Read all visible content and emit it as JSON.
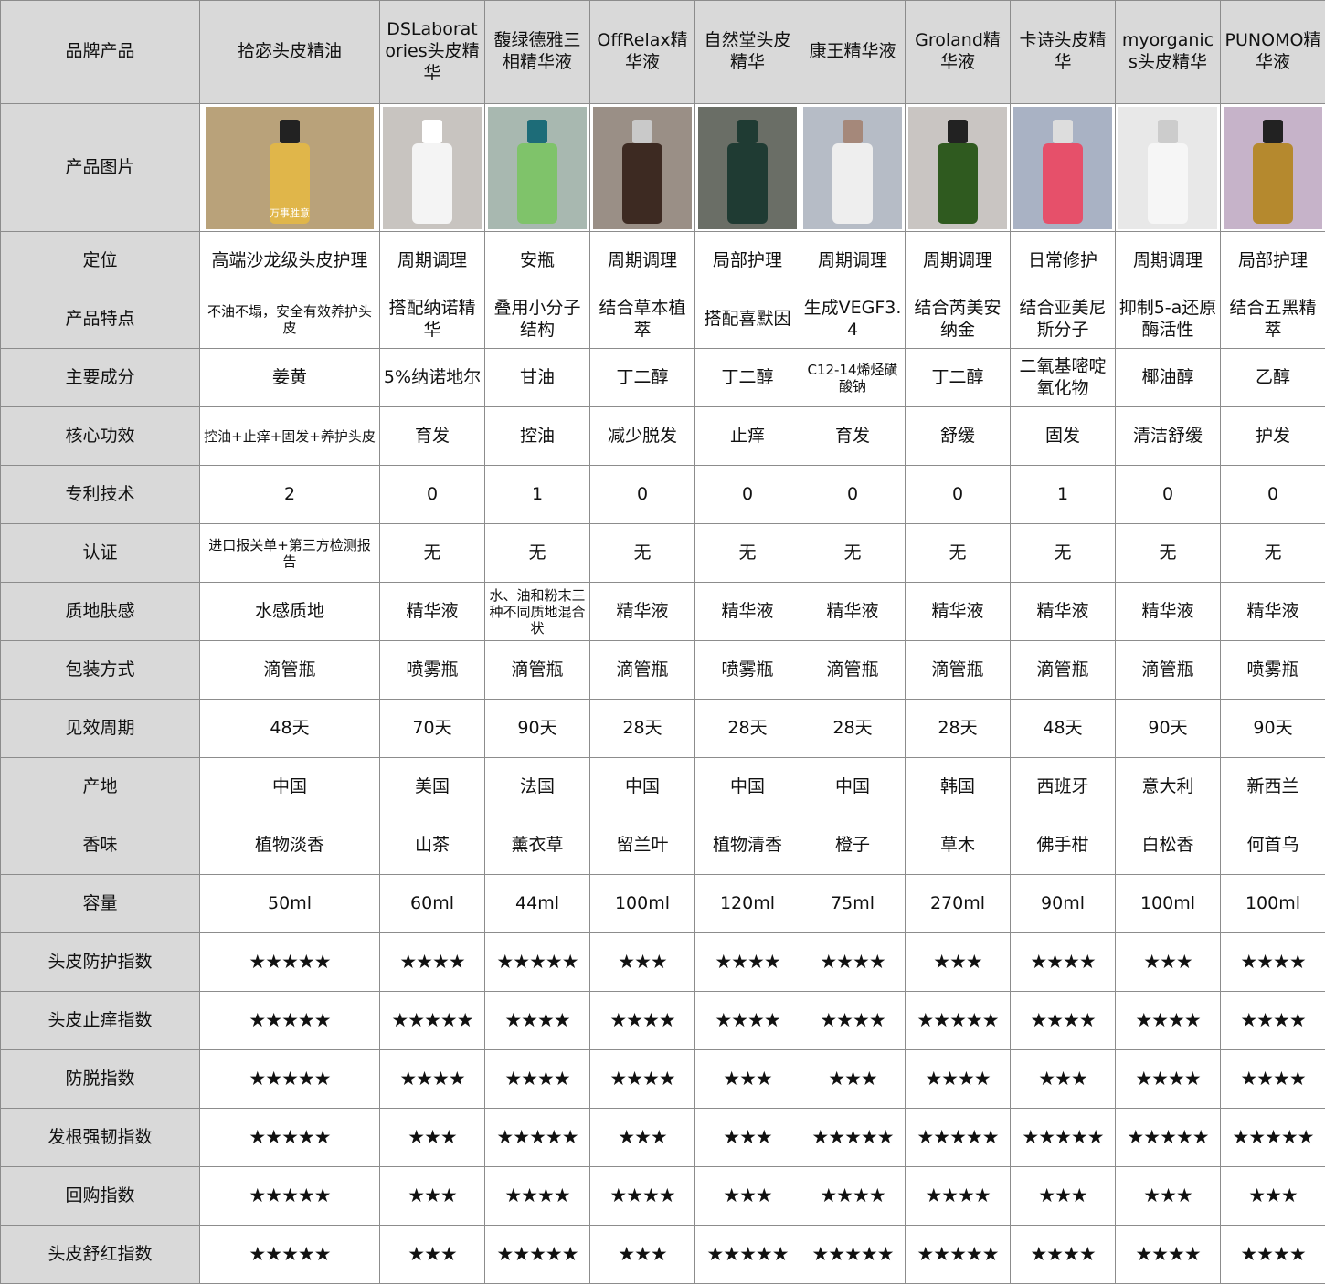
{
  "header": {
    "label": "品牌产品",
    "products": [
      "拾宓头皮精油",
      "DSLaboratories头皮精华",
      "馥绿德雅三相精华液",
      "OffRelax精华液",
      "自然堂头皮精华",
      "康王精华液",
      "Groland精华液",
      "卡诗头皮精华",
      "myorganics头皮精华",
      "PUNOMO精华液"
    ]
  },
  "image_row": {
    "label": "产品图片",
    "images": [
      {
        "icon": "serum-dropper-bottle-photo",
        "text": "万事胜意",
        "bg": "#b9a27a",
        "bottle": "#e0b64a",
        "cap": "#222222"
      },
      {
        "icon": "spray-bottle-photo",
        "text": "",
        "bg": "#c8c4c0",
        "bottle": "#f4f4f4",
        "cap": "#ffffff"
      },
      {
        "icon": "green-ampoule-photo",
        "text": "",
        "bg": "#a8b8b0",
        "bottle": "#7fc36a",
        "cap": "#1d6c78"
      },
      {
        "icon": "brown-bottle-photo",
        "text": "",
        "bg": "#9a8f86",
        "bottle": "#3d2a22",
        "cap": "#c9c9c9"
      },
      {
        "icon": "green-bottle-photo",
        "text": "",
        "bg": "#6a6e66",
        "bottle": "#1f3b33",
        "cap": "#1f3b33"
      },
      {
        "icon": "white-bottle-photo",
        "text": "",
        "bg": "#b6bcc6",
        "bottle": "#eeeeee",
        "cap": "#a5887a"
      },
      {
        "icon": "green-drop-bottle-photo",
        "text": "",
        "bg": "#c9c5c2",
        "bottle": "#2f5a1f",
        "cap": "#222222"
      },
      {
        "icon": "pink-serum-bottle-photo",
        "text": "",
        "bg": "#a9b2c4",
        "bottle": "#e6506a",
        "cap": "#dddddd"
      },
      {
        "icon": "white-box-bottle-photo",
        "text": "",
        "bg": "#e8e8e8",
        "bottle": "#f6f6f6",
        "cap": "#cccccc"
      },
      {
        "icon": "black-box-bottle-photo",
        "text": "",
        "bg": "#c6b3c9",
        "bottle": "#b5892e",
        "cap": "#222222"
      }
    ]
  },
  "rows": [
    {
      "label": "定位",
      "values": [
        "高端沙龙级头皮护理",
        "周期调理",
        "安瓶",
        "周期调理",
        "局部护理",
        "周期调理",
        "周期调理",
        "日常修护",
        "周期调理",
        "局部护理"
      ]
    },
    {
      "label": "产品特点",
      "values": [
        "不油不塌，安全有效养护头皮",
        "搭配纳诺精华",
        "叠用小分子结构",
        "结合草本植萃",
        "搭配喜默因",
        "生成VEGF3.4",
        "结合芮美安纳金",
        "结合亚美尼斯分子",
        "抑制5-a还原酶活性",
        "结合五黑精萃"
      ]
    },
    {
      "label": "主要成分",
      "values": [
        "姜黄",
        "5%纳诺地尔",
        "甘油",
        "丁二醇",
        "丁二醇",
        "C12-14烯烃磺酸钠",
        "丁二醇",
        "二氧基嘧啶氧化物",
        "椰油醇",
        "乙醇"
      ]
    },
    {
      "label": "核心功效",
      "values": [
        "控油+止痒+固发+养护头皮",
        "育发",
        "控油",
        "减少脱发",
        "止痒",
        "育发",
        "舒缓",
        "固发",
        "清洁舒缓",
        "护发"
      ]
    },
    {
      "label": "专利技术",
      "values": [
        "2",
        "0",
        "1",
        "0",
        "0",
        "0",
        "0",
        "1",
        "0",
        "0"
      ]
    },
    {
      "label": "认证",
      "values": [
        "进口报关单+第三方检测报告",
        "无",
        "无",
        "无",
        "无",
        "无",
        "无",
        "无",
        "无",
        "无"
      ]
    },
    {
      "label": "质地肤感",
      "values": [
        "水感质地",
        "精华液",
        "水、油和粉末三种不同质地混合状",
        "精华液",
        "精华液",
        "精华液",
        "精华液",
        "精华液",
        "精华液",
        "精华液"
      ]
    },
    {
      "label": "包装方式",
      "values": [
        "滴管瓶",
        "喷雾瓶",
        "滴管瓶",
        "滴管瓶",
        "喷雾瓶",
        "滴管瓶",
        "滴管瓶",
        "滴管瓶",
        "滴管瓶",
        "喷雾瓶"
      ]
    },
    {
      "label": "见效周期",
      "values": [
        "48天",
        "70天",
        "90天",
        "28天",
        "28天",
        "28天",
        "28天",
        "48天",
        "90天",
        "90天"
      ]
    },
    {
      "label": "产地",
      "values": [
        "中国",
        "美国",
        "法国",
        "中国",
        "中国",
        "中国",
        "韩国",
        "西班牙",
        "意大利",
        "新西兰"
      ]
    },
    {
      "label": "香味",
      "values": [
        "植物淡香",
        "山茶",
        "薰衣草",
        "留兰叶",
        "植物清香",
        "橙子",
        "草木",
        "佛手柑",
        "白松香",
        "何首乌"
      ]
    },
    {
      "label": "容量",
      "values": [
        "50ml",
        "60ml",
        "44ml",
        "100ml",
        "120ml",
        "75ml",
        "270ml",
        "90ml",
        "100ml",
        "100ml"
      ]
    }
  ],
  "star_rows": [
    {
      "label": "头皮防护指数",
      "stars": [
        5,
        4,
        5,
        3,
        4,
        4,
        3,
        4,
        3,
        4
      ]
    },
    {
      "label": "头皮止痒指数",
      "stars": [
        5,
        5,
        4,
        4,
        4,
        4,
        5,
        4,
        4,
        4
      ]
    },
    {
      "label": "防脱指数",
      "stars": [
        5,
        4,
        4,
        4,
        3,
        3,
        4,
        3,
        4,
        4
      ]
    },
    {
      "label": "发根强韧指数",
      "stars": [
        5,
        3,
        5,
        3,
        3,
        5,
        5,
        5,
        5,
        5
      ]
    },
    {
      "label": "回购指数",
      "stars": [
        5,
        3,
        4,
        4,
        3,
        4,
        4,
        3,
        3,
        3
      ]
    },
    {
      "label": "头皮舒红指数",
      "stars": [
        5,
        3,
        5,
        3,
        5,
        5,
        5,
        4,
        4,
        4
      ]
    }
  ],
  "star_glyph": "★"
}
